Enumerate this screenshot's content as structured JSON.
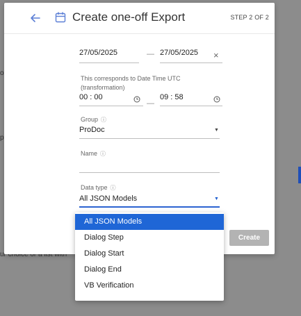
{
  "background": {
    "left_fragment_1": "o",
    "left_fragment_2": "p",
    "bottom_text": "ur choice or a list with"
  },
  "modal": {
    "title": "Create one-off Export",
    "step": "STEP 2 OF 2",
    "date_from": "27/05/2025",
    "date_to": "27/05/2025",
    "date_separator": "—",
    "clear_label": "×",
    "note_line1": "This corresponds to Date Time UTC",
    "note_line2": "(transformation)",
    "time_from": "00 : 00",
    "time_to": "09 : 58",
    "time_separator": "—",
    "group_label": "Group",
    "group_value": "ProDoc",
    "name_label": "Name",
    "name_value": "",
    "datatype_label": "Data type",
    "datatype_value": "All JSON Models",
    "info_glyph": "ⓘ",
    "caret_glyph": "▼",
    "create_label": "Create"
  },
  "dropdown": {
    "options": [
      "All JSON Models",
      "Dialog Step",
      "Dialog Start",
      "Dialog End",
      "VB Verification"
    ],
    "selected_index": 0
  },
  "colors": {
    "accent": "#1f66d6",
    "overlay": "#8c8c8c",
    "button_disabled": "#b3b3b3",
    "icon_blue": "#5b7fd6"
  },
  "icons": [
    "arrow-left-icon",
    "calendar-icon",
    "clock-icon",
    "info-icon",
    "chevron-down-icon",
    "close-icon"
  ]
}
